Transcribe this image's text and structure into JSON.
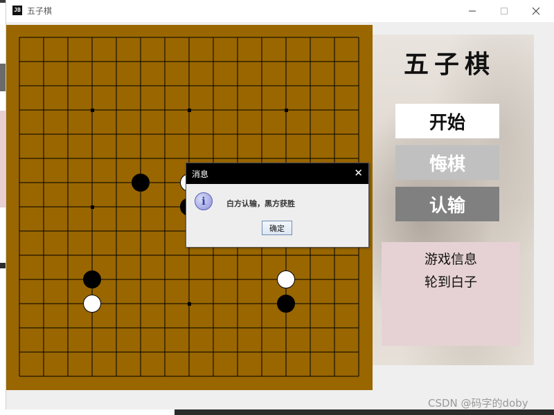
{
  "window": {
    "title": "五子棋",
    "app_icon_text": "JB"
  },
  "panel": {
    "game_title": "五子棋",
    "buttons": {
      "start": "开始",
      "undo": "悔棋",
      "resign": "认输"
    },
    "info_title": "游戏信息",
    "turn_text": "轮到白子"
  },
  "board": {
    "grid_lines": 15,
    "star_points": [
      [
        3,
        3
      ],
      [
        7,
        3
      ],
      [
        11,
        3
      ],
      [
        3,
        7
      ],
      [
        7,
        11
      ]
    ],
    "stones": [
      {
        "col": 5,
        "row": 6,
        "color": "black"
      },
      {
        "col": 7,
        "row": 6,
        "color": "white"
      },
      {
        "col": 7,
        "row": 7,
        "color": "black"
      },
      {
        "col": 3,
        "row": 10,
        "color": "black"
      },
      {
        "col": 3,
        "row": 11,
        "color": "white"
      },
      {
        "col": 11,
        "row": 10,
        "color": "white"
      },
      {
        "col": 11,
        "row": 11,
        "color": "black"
      }
    ],
    "colors": {
      "wood": "#996600",
      "line": "#000000"
    }
  },
  "dialog": {
    "title": "消息",
    "message": "白方认输，黑方获胜",
    "ok_label": "确定",
    "icon_glyph": "i"
  },
  "watermark": "CSDN @码字的doby"
}
